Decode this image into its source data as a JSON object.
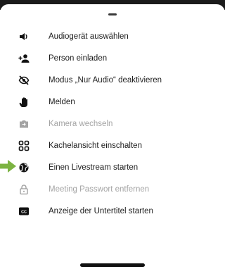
{
  "menu": {
    "items": [
      {
        "label": "Audiogerät auswählen",
        "icon": "speaker-icon",
        "enabled": true
      },
      {
        "label": "Person einladen",
        "icon": "add-person-icon",
        "enabled": true
      },
      {
        "label": "Modus „Nur Audio“ deaktivieren",
        "icon": "eye-off-icon",
        "enabled": true
      },
      {
        "label": "Melden",
        "icon": "raised-hand-icon",
        "enabled": true
      },
      {
        "label": "Kamera wechseln",
        "icon": "switch-camera-icon",
        "enabled": false
      },
      {
        "label": "Kachelansicht einschalten",
        "icon": "tile-view-icon",
        "enabled": true
      },
      {
        "label": "Einen Livestream starten",
        "icon": "globe-icon",
        "enabled": true
      },
      {
        "label": "Meeting Passwort entfernen",
        "icon": "lock-open-icon",
        "enabled": false
      },
      {
        "label": "Anzeige der Untertitel starten",
        "icon": "closed-captions-icon",
        "enabled": true
      }
    ]
  },
  "colors": {
    "text": "#1c1c1c",
    "disabled_text": "#a4a4a4",
    "icon": "#111111",
    "disabled_icon": "#a4a4a4",
    "pointer": "#7cb342"
  }
}
